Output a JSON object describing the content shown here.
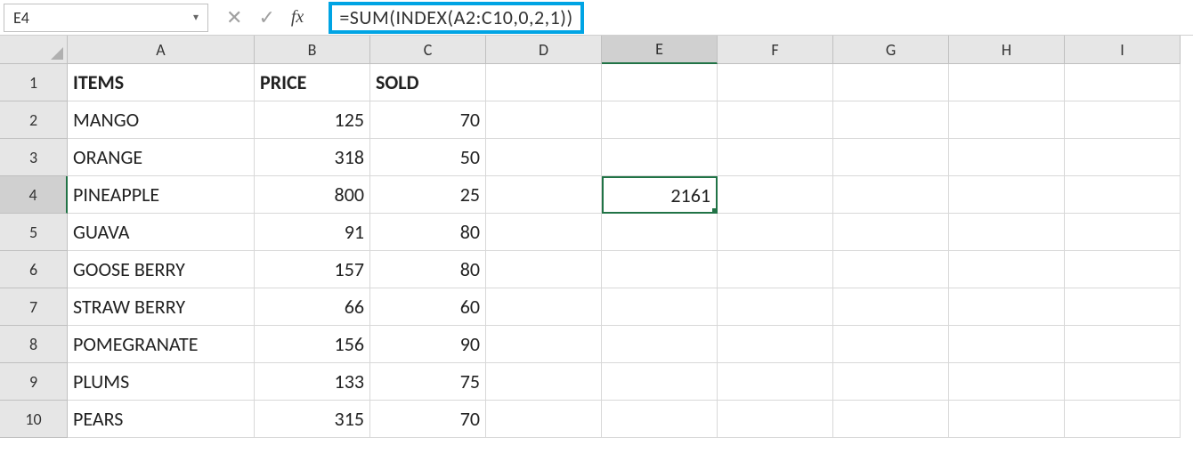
{
  "nameBox": "E4",
  "formula": "=SUM(INDEX(A2:C10,0,2,1))",
  "columns": [
    "A",
    "B",
    "C",
    "D",
    "E",
    "F",
    "G",
    "H",
    "I"
  ],
  "activeCol": "E",
  "activeRow": 4,
  "rows": [
    1,
    2,
    3,
    4,
    5,
    6,
    7,
    8,
    9,
    10
  ],
  "headers": {
    "A": "ITEMS",
    "B": "PRICE",
    "C": "SOLD"
  },
  "selectedCell": {
    "row": 4,
    "col": "E",
    "value": "2161"
  },
  "chart_data": {
    "type": "table",
    "columns": [
      "ITEMS",
      "PRICE",
      "SOLD"
    ],
    "rows": [
      {
        "ITEMS": "MANGO",
        "PRICE": 125,
        "SOLD": 70
      },
      {
        "ITEMS": "ORANGE",
        "PRICE": 318,
        "SOLD": 50
      },
      {
        "ITEMS": "PINEAPPLE",
        "PRICE": 800,
        "SOLD": 25
      },
      {
        "ITEMS": "GUAVA",
        "PRICE": 91,
        "SOLD": 80
      },
      {
        "ITEMS": "GOOSE BERRY",
        "PRICE": 157,
        "SOLD": 80
      },
      {
        "ITEMS": "STRAW BERRY",
        "PRICE": 66,
        "SOLD": 60
      },
      {
        "ITEMS": "POMEGRANATE",
        "PRICE": 156,
        "SOLD": 90
      },
      {
        "ITEMS": "PLUMS",
        "PRICE": 133,
        "SOLD": 75
      },
      {
        "ITEMS": "PEARS",
        "PRICE": 315,
        "SOLD": 70
      }
    ]
  }
}
